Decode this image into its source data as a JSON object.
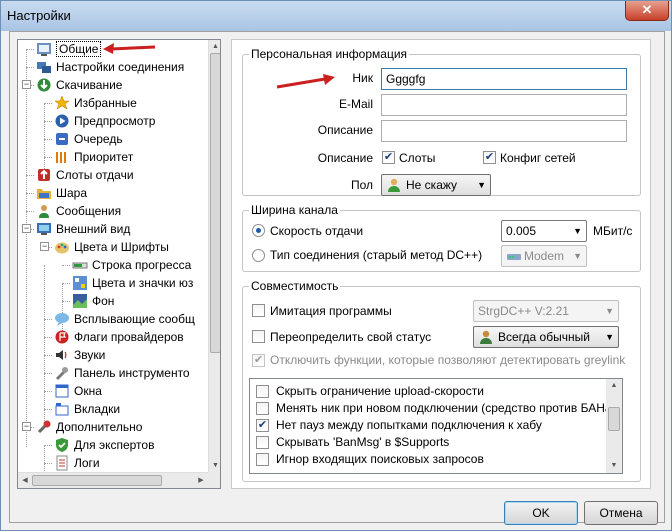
{
  "window": {
    "title": "Настройки",
    "close_glyph": "✕"
  },
  "tree": {
    "items": [
      {
        "label": "Общие",
        "icon": "general-settings-icon",
        "level": 1,
        "selected": true
      },
      {
        "label": "Настройки соединения",
        "icon": "network-connection-icon",
        "level": 1
      },
      {
        "label": "Скачивание",
        "icon": "download-icon",
        "level": 1,
        "expanded": true
      },
      {
        "label": "Избранные",
        "icon": "star-icon",
        "level": 2
      },
      {
        "label": "Предпросмотр",
        "icon": "preview-play-icon",
        "level": 2
      },
      {
        "label": "Очередь",
        "icon": "queue-icon",
        "level": 2
      },
      {
        "label": "Приоритет",
        "icon": "priority-bars-icon",
        "level": 2
      },
      {
        "label": "Слоты отдачи",
        "icon": "upload-slots-icon",
        "level": 1
      },
      {
        "label": "Шара",
        "icon": "share-folder-icon",
        "level": 1
      },
      {
        "label": "Сообщения",
        "icon": "messages-user-icon",
        "level": 1
      },
      {
        "label": "Внешний вид",
        "icon": "appearance-monitor-icon",
        "level": 1,
        "expanded": true
      },
      {
        "label": "Цвета и Шрифты",
        "icon": "colors-fonts-icon",
        "level": 2,
        "expanded": true
      },
      {
        "label": "Строка прогресса",
        "icon": "progress-bar-icon",
        "level": 3
      },
      {
        "label": "Цвета и значки юз",
        "icon": "user-icons-icon",
        "level": 3
      },
      {
        "label": "Фон",
        "icon": "background-icon",
        "level": 3
      },
      {
        "label": "Всплывающие сообщ",
        "icon": "popup-bubble-icon",
        "level": 2
      },
      {
        "label": "Флаги провайдеров",
        "icon": "provider-flag-icon",
        "level": 2
      },
      {
        "label": "Звуки",
        "icon": "sound-icon",
        "level": 2
      },
      {
        "label": "Панель инструменто",
        "icon": "toolbar-tools-icon",
        "level": 2
      },
      {
        "label": "Окна",
        "icon": "windows-icon",
        "level": 2
      },
      {
        "label": "Вкладки",
        "icon": "tabs-icon",
        "level": 2
      },
      {
        "label": "Дополнительно",
        "icon": "advanced-wrench-icon",
        "level": 1,
        "expanded": true
      },
      {
        "label": "Для экспертов",
        "icon": "expert-shield-icon",
        "level": 2
      },
      {
        "label": "Логи",
        "icon": "logs-icon",
        "level": 2
      }
    ]
  },
  "personal": {
    "title": "Персональная информация",
    "nick_label": "Ник",
    "nick_value": "Ggggfg",
    "email_label": "E-Mail",
    "email_value": "",
    "description_label": "Описание",
    "description_value": "",
    "desc_checks_label": "Описание",
    "slots_label": "Слоты",
    "slots_checked": true,
    "netconfig_label": "Конфиг сетей",
    "netconfig_checked": true,
    "gender_label": "Пол",
    "gender_value": "Не скажу",
    "gender_icon": "user-gender-icon"
  },
  "bandwidth": {
    "title": "Ширина канала",
    "speed_label": "Скорость отдачи",
    "speed_selected": true,
    "speed_value": "0.005",
    "speed_unit": "МБит/с",
    "conn_type_label": "Тип соединения (старый метод DC++)",
    "conn_type_value": "Modem",
    "conn_type_icon": "modem-icon"
  },
  "compat": {
    "title": "Совместимость",
    "emulate_label": "Имитация программы",
    "emulate_value": "StrgDC++ V:2.21",
    "override_status_label": "Переопределить свой статус",
    "override_status_value": "Всегда обычный",
    "override_status_icon": "user-status-icon",
    "greylink_label": "Отключить функции, которые позволяют детектировать greylink",
    "list": [
      {
        "label": "Скрыть ограничение upload-скорости",
        "checked": false
      },
      {
        "label": "Менять ник при новом подключении (средство против БАНа)",
        "checked": false
      },
      {
        "label": "Нет пауз между попытками подключения к хабу",
        "checked": true
      },
      {
        "label": "Скрывать 'BanMsg' в $Supports",
        "checked": false
      },
      {
        "label": "Игнор входящих поисковых запросов",
        "checked": false
      }
    ]
  },
  "buttons": {
    "ok": "OK",
    "cancel": "Отмена"
  },
  "colors": {
    "annotation_arrow": "#cc1f1f",
    "title_bar": "#b9d1ea",
    "selection_accent": "#1c5aa6"
  }
}
